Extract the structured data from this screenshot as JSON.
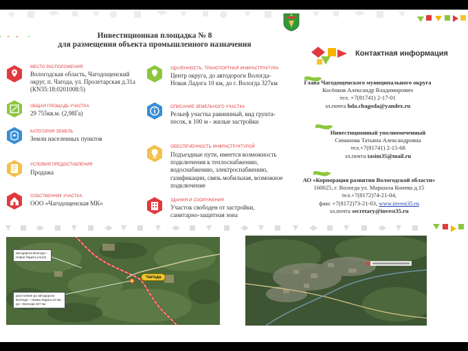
{
  "header": {
    "title_line1": "Инвестиционная площадка № 8",
    "title_line2": "для размещения объекта промышленного назначения"
  },
  "colors": {
    "accent_red": "#e03a3e",
    "accent_green": "#8cc63f",
    "accent_yellow": "#f7b500",
    "icon_fill": "#f2c14e"
  },
  "left_items": [
    {
      "label": "МЕСТО РАСПОЛОЖЕНИЯ",
      "lines": [
        "Вологодская область, Чагодощенский",
        "округ, п. Чагода,  ул. Пролетарская д.31а",
        "(КN35:18:0201008:5)"
      ],
      "icon": "map-pin-icon",
      "icon_color": "#e03a3e"
    },
    {
      "label": "ОБЩАЯ ПЛОЩАДЬ УЧАСТКА",
      "lines": [
        "29 755кв.м. (2,98Га)"
      ],
      "icon": "area-icon",
      "icon_color": "#8cc63f"
    },
    {
      "label": "КАТЕГОРИЯ ЗЕМЕЛЬ",
      "lines": [
        "Земли  населенных пунктов"
      ],
      "icon": "land-category-icon",
      "icon_color": "#3a8fd6"
    },
    {
      "label": "УСЛОВИЯ ПРЕДОСТАВЛЕНИЯ",
      "lines": [
        "Продажа"
      ],
      "icon": "document-icon",
      "icon_color": "#f2c14e"
    },
    {
      "label": "СОБСТВЕННИК УЧАСТКА",
      "lines": [
        "ООО «Чагодощенская МК»"
      ],
      "icon": "owner-house-icon",
      "icon_color": "#e03a3e"
    }
  ],
  "right_items": [
    {
      "label": "УДАЛЕННОСТЬ, ТРАНСПОРТНАЯ ИНФРАСТРУКТУРА",
      "lines": [
        "Центр округа, до автодороги Вологда-",
        "Новая Ладога 10 км, до г. Вологда 327км"
      ],
      "icon": "transport-icon",
      "icon_color": "#8cc63f"
    },
    {
      "label": "ОПИСАНИЕ ЗЕМЕЛЬНОГО УЧАСТКА",
      "lines": [
        "Рельеф участка равнинный, вид грунта-",
        "песок, в 100 м - жилые застройки"
      ],
      "icon": "info-icon",
      "icon_color": "#3a8fd6"
    },
    {
      "label": "ОБЕСПЕЧЕННОСТЬ ИНФРАСТРУКТУРОЙ",
      "lines": [
        "Подъездные пути, имеется возможность",
        "подключения к теплоснабжению,",
        "водоснабжению, электроснабжению,",
        "газификации, связь мобильная, возможное",
        "подключение"
      ],
      "icon": "lightbulb-icon",
      "icon_color": "#f2c14e"
    },
    {
      "label": "ЗДАНИЯ И СООРУЖЕНИЯ",
      "lines": [
        "Участок свободен от застройки,",
        "санитарно-защитная зона"
      ],
      "icon": "building-icon",
      "icon_color": "#e03a3e"
    }
  ],
  "contacts": {
    "title": "Контактная информация",
    "blocks": [
      {
        "heading": "Глава Чагодощенского муниципального округа",
        "lines": [
          "Косёнков Александр Владимирович",
          "тел. +7(81741) 2-17-01"
        ],
        "email_prefix": "эл.почта ",
        "email": "hda.chagoda@yandex.ru"
      },
      {
        "heading": "Инвестиционный уполномоченный",
        "lines": [
          "Симанова Татьяна Александровна",
          "тел.+7(81741) 2-15-68"
        ],
        "email_prefix": "эл.почта ",
        "email": "tasim35@mail.ru"
      },
      {
        "heading": "АО «Корпорация развития Вологодской области»",
        "lines": [
          "160025, г. Вологда ул. Маршала Конева д.15",
          "тел.+7(8172)74-21-04,"
        ],
        "fax_prefix": "факс +7(8172)73-21-03, ",
        "website": "www.invest35.ru",
        "email_prefix": "эл.почта ",
        "email": "secretary@invest35.ru"
      }
    ]
  },
  "maps": {
    "left": {
      "callout_road": "автодорога Вологда – Новая Ладога (А114)",
      "callout_distance": "расстояние до автодороги Вологда – Новая Ладога 10 км., до г. Вологда 327 км.",
      "town_label": "Чагода"
    }
  }
}
